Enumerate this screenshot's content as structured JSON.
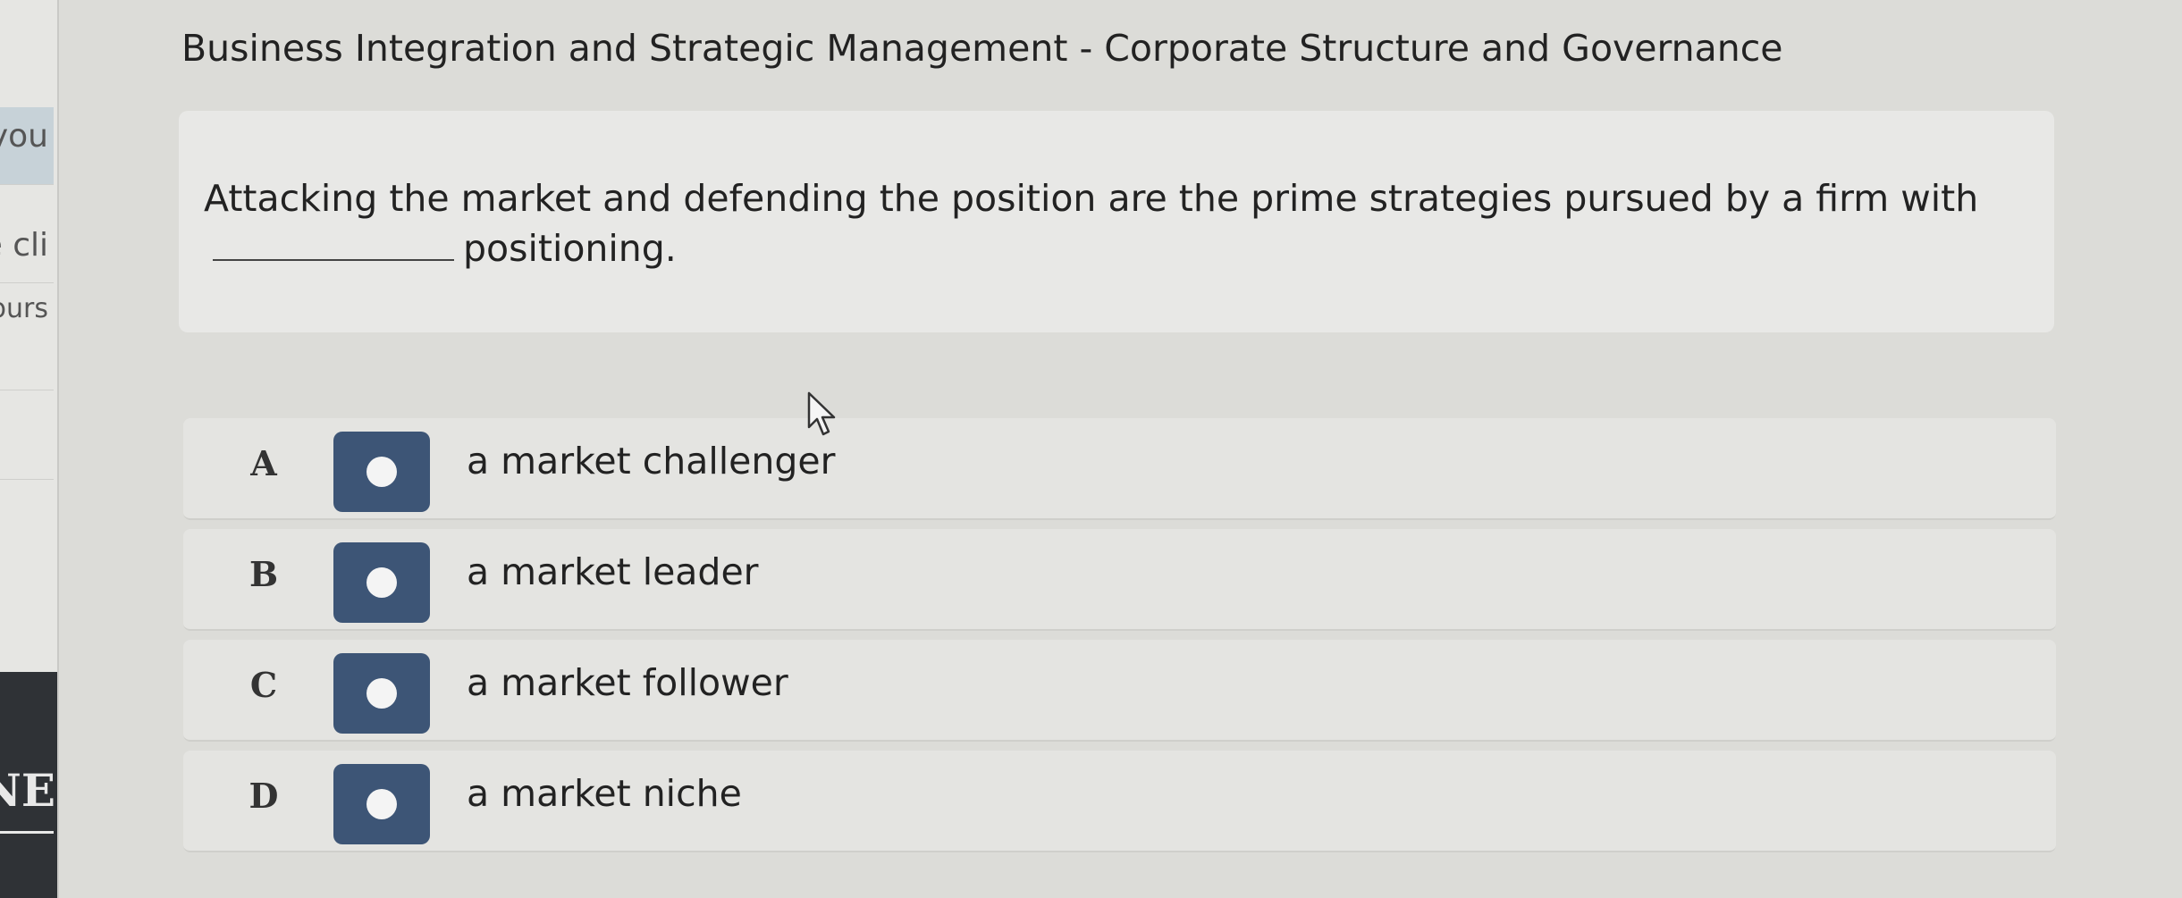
{
  "sidebar": {
    "fragments": [
      "you",
      "e cli",
      "ours"
    ],
    "logo_fragment": "NE"
  },
  "page": {
    "title": "Business Integration and Strategic Management - Corporate Structure and Governance"
  },
  "question": {
    "text_before_blank": "Attacking the market and defending the position are the prime strategies pursued by a firm with",
    "text_after_blank": "positioning."
  },
  "options": [
    {
      "letter": "A",
      "text": "a market challenger"
    },
    {
      "letter": "B",
      "text": "a market leader"
    },
    {
      "letter": "C",
      "text": "a market follower"
    },
    {
      "letter": "D",
      "text": "a market niche"
    }
  ],
  "colors": {
    "radio_button": "#3d5576",
    "background": "#dcdcd8"
  },
  "icons": {
    "cursor": "arrow-cursor-icon",
    "radio": "radio-dot-icon"
  }
}
